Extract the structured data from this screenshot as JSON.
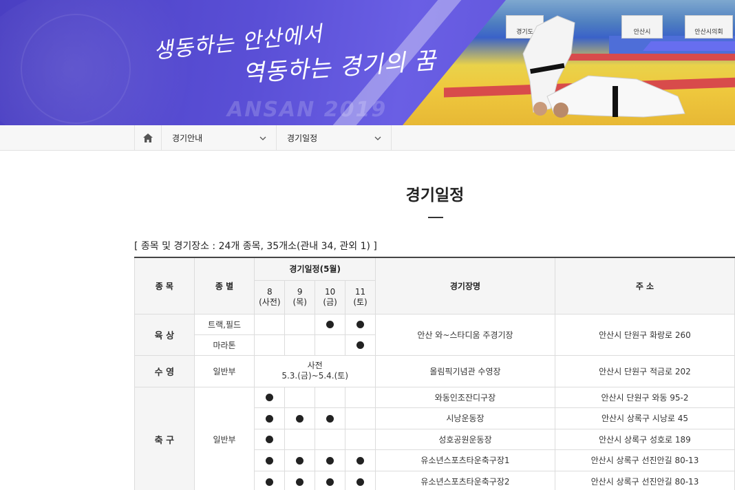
{
  "banner": {
    "slogan_line1": "생동하는 안산에서",
    "slogan_line2": "역동하는 경기의 꿈",
    "watermark": "ANSAN 2019",
    "signs": [
      "경기도",
      "안산시",
      "안산시의회"
    ]
  },
  "nav": {
    "home_icon": "home-icon",
    "dropdown1": "경기안내",
    "dropdown2": "경기일정",
    "chevron_icon": "chevron-down-icon"
  },
  "page": {
    "title": "경기일정",
    "summary": "[ 종목 및 경기장소 : 24개 종목, 35개소(관내 34, 관외 1) ]"
  },
  "table": {
    "headers": {
      "sport": "종 목",
      "type": "종 별",
      "schedule": "경기일정(5월)",
      "days": [
        "8\n(사전)",
        "9\n(목)",
        "10\n(금)",
        "11\n(토)"
      ],
      "venue": "경기장명",
      "address": "주 소"
    },
    "rows": [
      {
        "sport": "육 상",
        "type": "트랙,필드",
        "dots": [
          false,
          false,
          true,
          true
        ],
        "venue": "안산 와~스타디움 주경기장",
        "address": "안산시 단원구 화랑로 260"
      },
      {
        "sport": "",
        "type": "마라톤",
        "dots": [
          false,
          false,
          false,
          true
        ],
        "venue": "",
        "address": ""
      },
      {
        "sport": "수 영",
        "type": "일반부",
        "schedule_text": "사전\n5.3.(금)~5.4.(토)",
        "venue": "올림픽기념관 수영장",
        "address": "안산시 단원구 적금로 202"
      },
      {
        "sport": "축 구",
        "type": "일반부",
        "dots": [
          true,
          false,
          false,
          false
        ],
        "venue": "와동인조잔디구장",
        "address": "안산시 단원구 와동 95-2"
      },
      {
        "sport": "",
        "type": "",
        "dots": [
          true,
          true,
          true,
          false
        ],
        "venue": "시낭운동장",
        "address": "안산시 상록구 시낭로 45"
      },
      {
        "sport": "",
        "type": "",
        "dots": [
          true,
          false,
          false,
          false
        ],
        "venue": "성호공원운동장",
        "address": "안산시 상록구 성호로 189"
      },
      {
        "sport": "",
        "type": "",
        "dots": [
          true,
          true,
          true,
          true
        ],
        "venue": "유소년스포츠타운축구장1",
        "address": "안산시 상록구 선진안길 80-13"
      },
      {
        "sport": "",
        "type": "",
        "dots": [
          true,
          true,
          true,
          true
        ],
        "venue": "유소년스포츠타운축구장2",
        "address": "안산시 상록구 선진안길 80-13"
      }
    ]
  }
}
